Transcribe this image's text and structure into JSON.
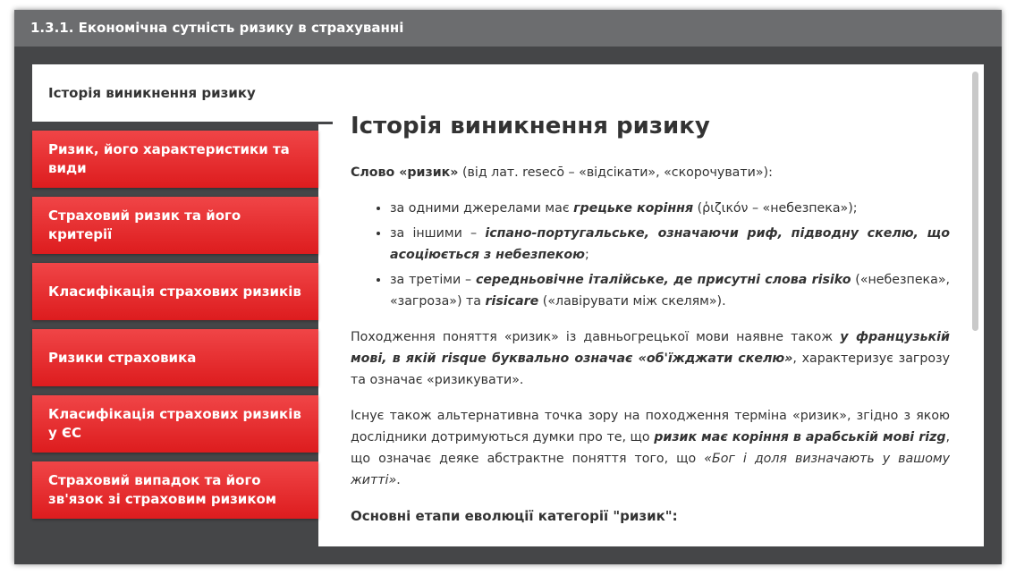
{
  "window": {
    "title": "1.3.1. Економічна сутність ризику в страхуванні"
  },
  "tabs": [
    {
      "label": "Історія виникнення ризику",
      "active": true
    },
    {
      "label": "Ризик, його характеристики та види"
    },
    {
      "label": "Страховий ризик та його критерії"
    },
    {
      "label": "Класифікація страхових ризиків"
    },
    {
      "label": "Ризики страховика"
    },
    {
      "label": "Класифікація страхових ризиків у ЄС"
    },
    {
      "label": "Страховий випадок та його зв'язок зі страховим ризиком"
    }
  ],
  "article": {
    "heading": "Історія виникнення ризику",
    "intro_bold": "Слово «ризик»",
    "intro_rest": " (від лат. resecō – «відсікати», «скорочувати»):",
    "bullets": [
      {
        "pre": "за одними джерелами має ",
        "emph": "грецьке коріння",
        "post": " (ῥιζικόν – «небезпека»);"
      },
      {
        "pre": "за іншими – ",
        "emph": "іспано-португальське, означаючи риф, підводну скелю, що асоціюється з небезпекою",
        "post": ";"
      },
      {
        "pre": "за третіми – ",
        "emph": "середньовічне італійське, де присутні слова risiko",
        "mid": " («небезпека», «загроза») та ",
        "emph2": "risicare",
        "post": " («лавірувати між скелям»)."
      }
    ],
    "p1_pre": "Походження поняття «ризик» із давньогрецької мови наявне також ",
    "p1_emph": "у французькій мові, в якій risque буквально означає «об'їжджати скелю»",
    "p1_post": ", характеризує загрозу та означає «ризикувати».",
    "p2_pre": "Існує також альтернативна точка зору на походження терміна «ризик», згідно з якою дослідники дотримуються думки про те, що ",
    "p2_emph": "ризик має коріння в арабській мові rizg",
    "p2_mid": ", що означає деяке абстрактне поняття того, що ",
    "p2_ital": "«Бог і доля визначають у вашому житті»",
    "p2_post": ".",
    "subheading": "Основні етапи еволюції категорії \"ризик\":"
  },
  "colors": {
    "accent": "#e52528",
    "frame": "#454648",
    "titlebar": "#6c6d6f"
  }
}
